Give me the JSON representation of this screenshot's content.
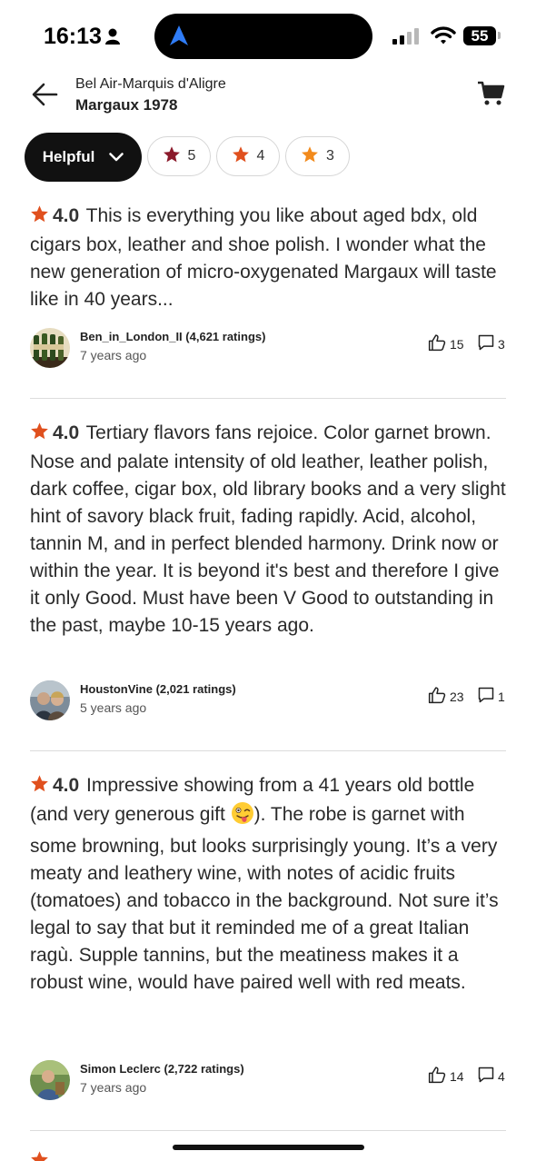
{
  "status_bar": {
    "time": "16:13",
    "battery": "55"
  },
  "header": {
    "subtitle": "Bel Air-Marquis d'Aligre",
    "title": "Margaux 1978"
  },
  "filters": {
    "sort_label": "Helpful",
    "chips": [
      {
        "label": "5",
        "star_color": "#8b1a2b"
      },
      {
        "label": "4",
        "star_color": "#e0501e"
      },
      {
        "label": "3",
        "star_color": "#f28a1c"
      }
    ]
  },
  "colors": {
    "rating_star": "#e0501e",
    "text": "#2a2a2a"
  },
  "reviews": [
    {
      "rating": "4.0",
      "text": "This is everything you like about aged bdx, old cigars box, leather and shoe polish. I wonder what the new generation of micro-oxygenated Margaux will taste like in 40 years...",
      "user": "Ben_in_London_II",
      "user_ratings": "(4,621 ratings)",
      "time_ago": "7 years ago",
      "likes": "15",
      "comments": "3"
    },
    {
      "rating": "4.0",
      "text": "Tertiary flavors fans rejoice. Color garnet brown. Nose and palate intensity of old leather, leather polish, dark coffee, cigar box, old library books and a very slight hint of savory black fruit, fading rapidly. Acid, alcohol, tannin M, and in perfect blended harmony. Drink now or within the year. It is beyond it's best and therefore I give it only Good. Must have been V Good to outstanding in the past, maybe 10-15 years ago.",
      "user": "HoustonVine",
      "user_ratings": "(2,021 ratings)",
      "time_ago": "5 years ago",
      "likes": "23",
      "comments": "1"
    },
    {
      "rating": "4.0",
      "text_before_emoji": "Impressive showing from a 41 years old bottle (and very generous gift ",
      "text_after_emoji": "). The robe is garnet with some browning, but looks surprisingly young. It’s a very meaty and leathery wine, with notes of acidic fruits (tomatoes) and tobacco in the background. Not sure it’s legal to say that but it reminded me of a great Italian ragù. Supple tannins, but the meatiness makes it a robust wine, would have paired well with red meats.",
      "emoji": "winking-face-with-tongue",
      "user": "Simon Leclerc",
      "user_ratings": "(2,722 ratings)",
      "time_ago": "7 years ago",
      "likes": "14",
      "comments": "4"
    }
  ],
  "icons": [
    "person-icon",
    "navigation-arrow-icon",
    "cellular-signal-icon",
    "wifi-icon",
    "back-arrow-icon",
    "cart-icon",
    "chevron-down-icon",
    "star-icon",
    "thumbs-up-icon",
    "comment-icon"
  ]
}
